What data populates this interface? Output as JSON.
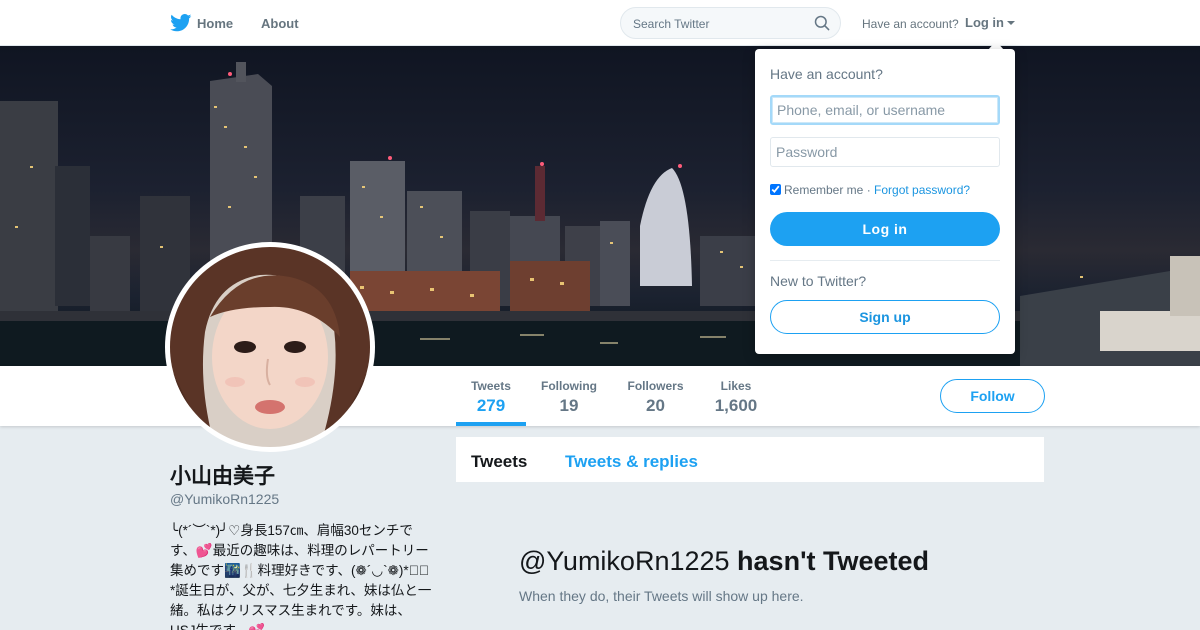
{
  "nav": {
    "home": "Home",
    "about": "About",
    "search_placeholder": "Search Twitter",
    "have_account": "Have an account?",
    "login": "Log in"
  },
  "icons": {
    "logo": "twitter-bird-icon",
    "search": "search-icon",
    "caret": "caret-down-icon"
  },
  "colors": {
    "accent": "#1da1f2",
    "background": "#e6ecf0",
    "muted_text": "#657786"
  },
  "profile": {
    "name": "小山由美子",
    "handle": "@YumikoRn1225",
    "bio": "╰(*´︶`*)╯♡身長157㎝、肩幅30センチです、💕最近の趣味は、料理のレパートリー集めです🌃🍴料理好きです、(❁´◡`❁)*✲ﾟ*誕生日が、父が、七夕生まれ、妹は仏と一緒。私はクリスマス生まれです。妹は、USJ生です。💕"
  },
  "stats": [
    {
      "label": "Tweets",
      "value": "279"
    },
    {
      "label": "Following",
      "value": "19"
    },
    {
      "label": "Followers",
      "value": "20"
    },
    {
      "label": "Likes",
      "value": "1,600"
    }
  ],
  "follow_label": "Follow",
  "tabs": {
    "tweets": "Tweets",
    "replies": "Tweets & replies"
  },
  "empty_state": {
    "handle": "@YumikoRn1225",
    "suffix": "hasn't Tweeted",
    "subtitle": "When they do, their Tweets will show up here."
  },
  "login_dropdown": {
    "question": "Have an account?",
    "username_placeholder": "Phone, email, or username",
    "password_placeholder": "Password",
    "remember": "Remember me",
    "separator": " · ",
    "forgot": "Forgot password?",
    "login_button": "Log in",
    "new_to": "New to Twitter?",
    "signup_button": "Sign up"
  }
}
